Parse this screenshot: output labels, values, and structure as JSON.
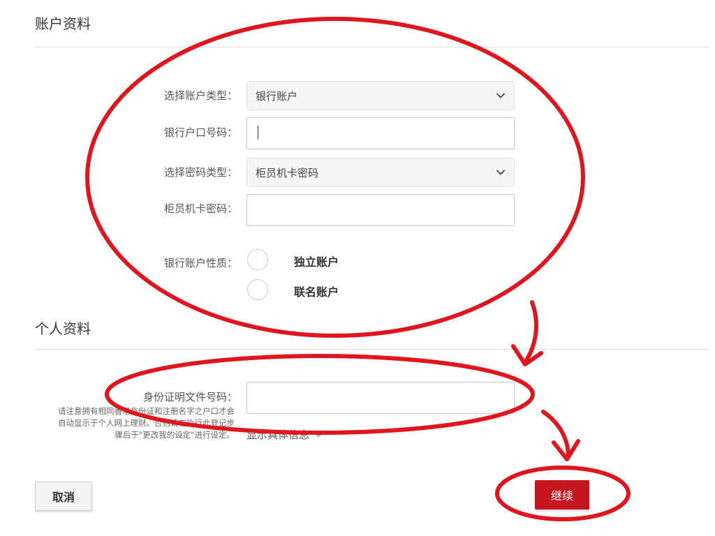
{
  "account_section": {
    "title": "账户资料",
    "account_type": {
      "label": "选择账户类型：",
      "value": "银行账户"
    },
    "account_number": {
      "label": "银行户口号码：",
      "value": ""
    },
    "pin_type": {
      "label": "选择密码类型：",
      "value": "柜员机卡密码"
    },
    "pin": {
      "label": "柜员机卡密码：",
      "value": ""
    },
    "account_nature": {
      "label": "银行账户性质：",
      "options": [
        "独立账户",
        "联名账户"
      ]
    }
  },
  "personal_section": {
    "title": "个人资料",
    "id_number": {
      "label": "身份证明文件号码：",
      "value": ""
    },
    "note": "请注意拥有相同香港身份证和注册名字之户口才会自动显示于个人网上理财。否则请在执行此登记步骤后于\"更改我的设定\"进行设定。",
    "details_link": "显示具体信息"
  },
  "actions": {
    "cancel_label": "取消",
    "continue_label": "继续"
  },
  "annotation_color": "#e0161e",
  "icons": {
    "select_arrow": "chevron-down-icon",
    "details_arrow": "chevron-down-icon"
  }
}
